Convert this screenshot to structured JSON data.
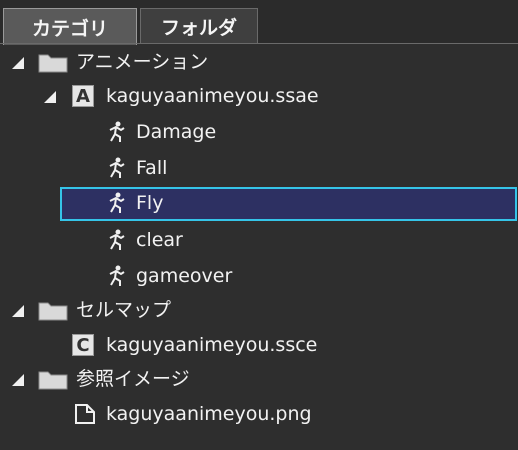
{
  "tabs": [
    {
      "label": "カテゴリ",
      "active": true
    },
    {
      "label": "フォルダ",
      "active": false
    }
  ],
  "tree": {
    "animation_folder": "アニメーション",
    "ssae_file": "kaguyaanimeyou.ssae",
    "ssae_letter": "A",
    "animations": [
      "Damage",
      "Fall",
      "Fly",
      "clear",
      "gameover"
    ],
    "selected_animation": "Fly",
    "cellmap_folder": "セルマップ",
    "ssce_file": "kaguyaanimeyou.ssce",
    "ssce_letter": "C",
    "image_folder": "参照イメージ",
    "png_file": "kaguyaanimeyou.png"
  },
  "colors": {
    "background": "#2e2e2e",
    "selection_fill": "#2d3062",
    "selection_border": "#35c4e8"
  }
}
